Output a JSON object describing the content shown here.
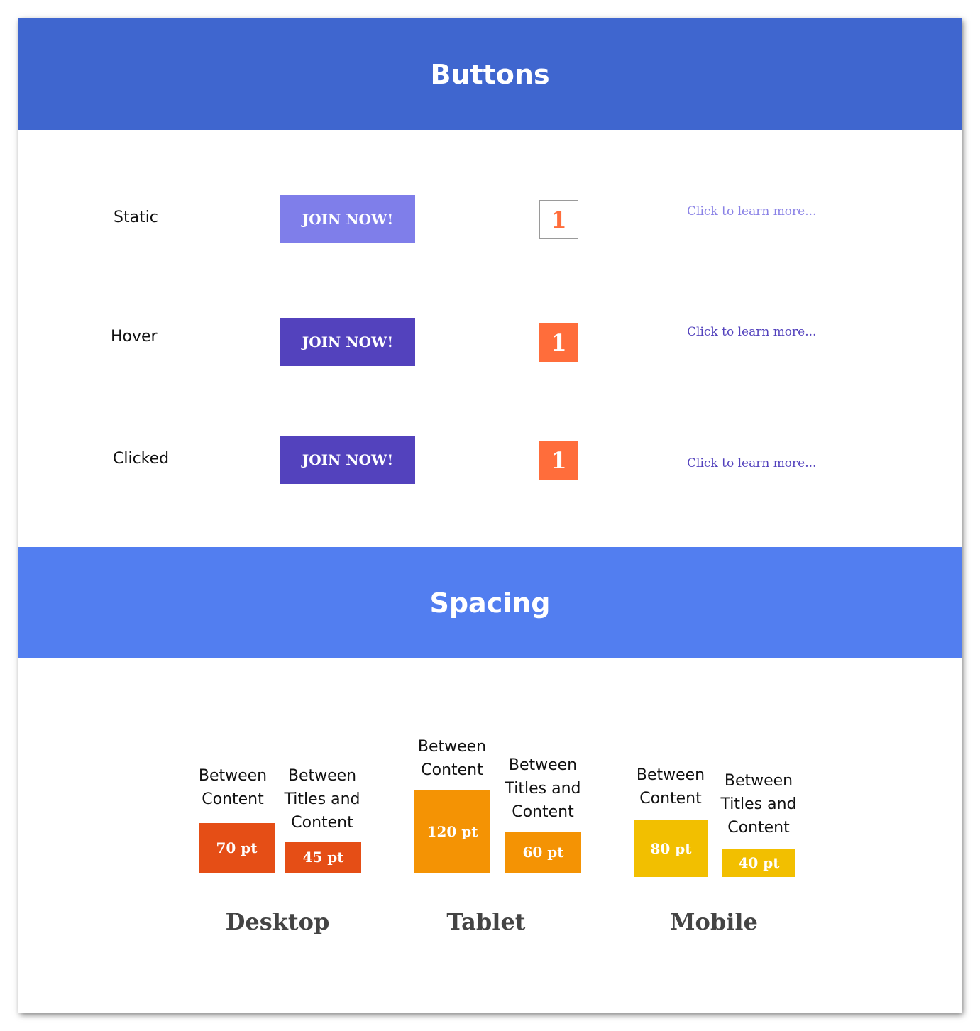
{
  "buttons_section": {
    "title": "Buttons",
    "rows": [
      {
        "state": "Static",
        "button_label": "JOIN NOW!",
        "page_number": "1",
        "link_text": "Click to learn more..."
      },
      {
        "state": "Hover",
        "button_label": "JOIN NOW!",
        "page_number": "1",
        "link_text": "Click to learn more..."
      },
      {
        "state": "Clicked",
        "button_label": "JOIN NOW!",
        "page_number": "1",
        "link_text": "Click to learn more..."
      }
    ]
  },
  "spacing_section": {
    "title": "Spacing",
    "devices": [
      {
        "name": "Desktop",
        "color": "#e54e16",
        "between_content": {
          "label": "Between Content",
          "value": "70 pt"
        },
        "between_titles": {
          "label": "Between Titles and Content",
          "value": "45 pt"
        }
      },
      {
        "name": "Tablet",
        "color": "#f49304",
        "between_content": {
          "label": "Between Content",
          "value": "120 pt"
        },
        "between_titles": {
          "label": "Between Titles and Content",
          "value": "60 pt"
        }
      },
      {
        "name": "Mobile",
        "color": "#f2bf00",
        "between_content": {
          "label": "Between Content",
          "value": "80 pt"
        },
        "between_titles": {
          "label": "Between Titles and Content",
          "value": "40 pt"
        }
      }
    ]
  },
  "colors": {
    "buttons_banner": "#3f66cf",
    "spacing_banner": "#527ef0",
    "button_static": "#7f7eea",
    "button_active": "#5342bd",
    "page_accent": "#ff6d3b",
    "link_static": "#8a82e6",
    "link_active": "#5342bd"
  }
}
